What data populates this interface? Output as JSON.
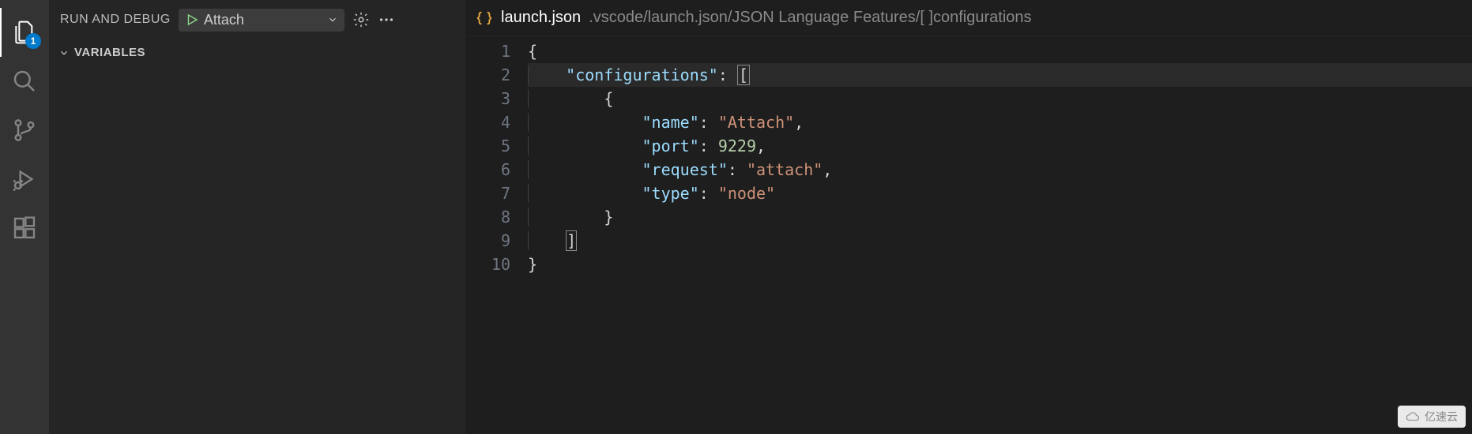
{
  "activityBar": {
    "explorerBadge": "1"
  },
  "sidebar": {
    "title": "RUN AND DEBUG",
    "configName": "Attach",
    "sections": {
      "variables": "VARIABLES"
    }
  },
  "editor": {
    "tabTitle": "launch.json",
    "tabPath": ".vscode/launch.json/JSON Language Features/[  ]configurations",
    "lineNumbers": [
      "1",
      "2",
      "3",
      "4",
      "5",
      "6",
      "7",
      "8",
      "9",
      "10"
    ],
    "code": {
      "l1": "{",
      "l2_key": "\"configurations\"",
      "l2_colon": ": ",
      "l2_bracket": "[",
      "l3": "{",
      "l4_key": "\"name\"",
      "l4_val": "\"Attach\"",
      "l5_key": "\"port\"",
      "l5_val": "9229",
      "l6_key": "\"request\"",
      "l6_val": "\"attach\"",
      "l7_key": "\"type\"",
      "l7_val": "\"node\"",
      "l8": "}",
      "l9": "]",
      "l10": "}"
    }
  },
  "watermark": {
    "text": "亿速云"
  }
}
